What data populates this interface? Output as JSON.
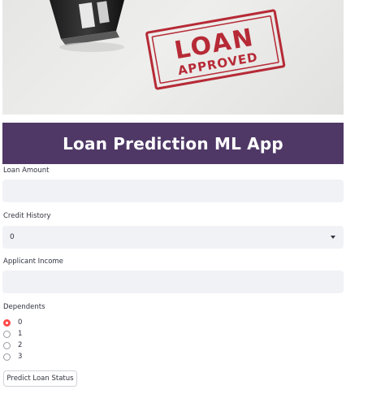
{
  "hero": {
    "stamp_line1": "LOAN",
    "stamp_line2": "APPROVED",
    "stamp_color": "#b62a36"
  },
  "app": {
    "title": "Loan Prediction ML App",
    "banner_color": "#4f3866"
  },
  "form": {
    "loan_amount": {
      "label": "Loan Amount",
      "value": ""
    },
    "credit_history": {
      "label": "Credit History",
      "selected": "0"
    },
    "applicant_income": {
      "label": "Applicant Income",
      "value": ""
    },
    "dependents": {
      "label": "Dependents",
      "options": [
        "0",
        "1",
        "2",
        "3"
      ],
      "selected": "0"
    },
    "submit_label": "Predict Loan Status"
  },
  "colors": {
    "input_bg": "#f0f2f6",
    "radio_selected": "#ff4b4b"
  }
}
